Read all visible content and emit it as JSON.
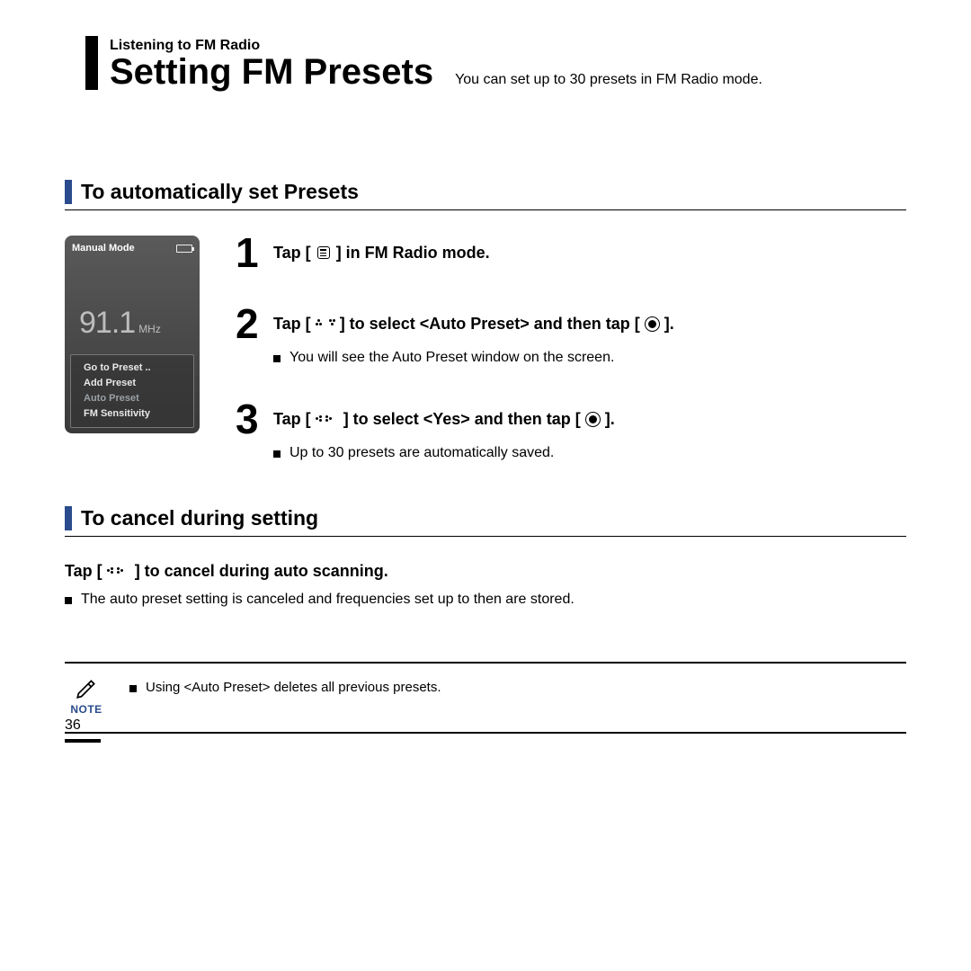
{
  "header": {
    "breadcrumb": "Listening to FM Radio",
    "title": "Setting FM Presets",
    "subtitle": "You can set up to 30 presets in FM Radio mode."
  },
  "section1": {
    "heading": "To automatically set Presets",
    "device": {
      "mode": "Manual Mode",
      "frequency": "91.1",
      "unit": "MHz",
      "menu": [
        "Go to Preset ..",
        "Add Preset",
        "Auto Preset",
        "FM Sensitivity"
      ]
    },
    "steps": [
      {
        "num": "1",
        "title_pre": "Tap [ ",
        "title_post": " ] in FM Radio mode.",
        "icon": "menu"
      },
      {
        "num": "2",
        "title_pre": "Tap [ ",
        "title_mid": " ] to select <Auto Preset> and then tap [",
        "title_post": "].",
        "icon": "updown",
        "icon2": "circle",
        "detail": "You will see the Auto Preset window on the screen."
      },
      {
        "num": "3",
        "title_pre": "Tap [ ",
        "title_mid": " ] to select <Yes> and then tap [",
        "title_post": "].",
        "icon": "leftright",
        "icon2": "circle",
        "detail": "Up to 30 presets are automatically saved."
      }
    ]
  },
  "section2": {
    "heading": "To cancel during setting",
    "title_pre": "Tap [ ",
    "title_post": " ] to cancel during auto scanning.",
    "icon": "leftright",
    "detail": "The auto preset setting is canceled and frequencies set up to then are stored."
  },
  "note": {
    "label": "NOTE",
    "text": "Using <Auto Preset> deletes all previous presets."
  },
  "page_number": "36"
}
